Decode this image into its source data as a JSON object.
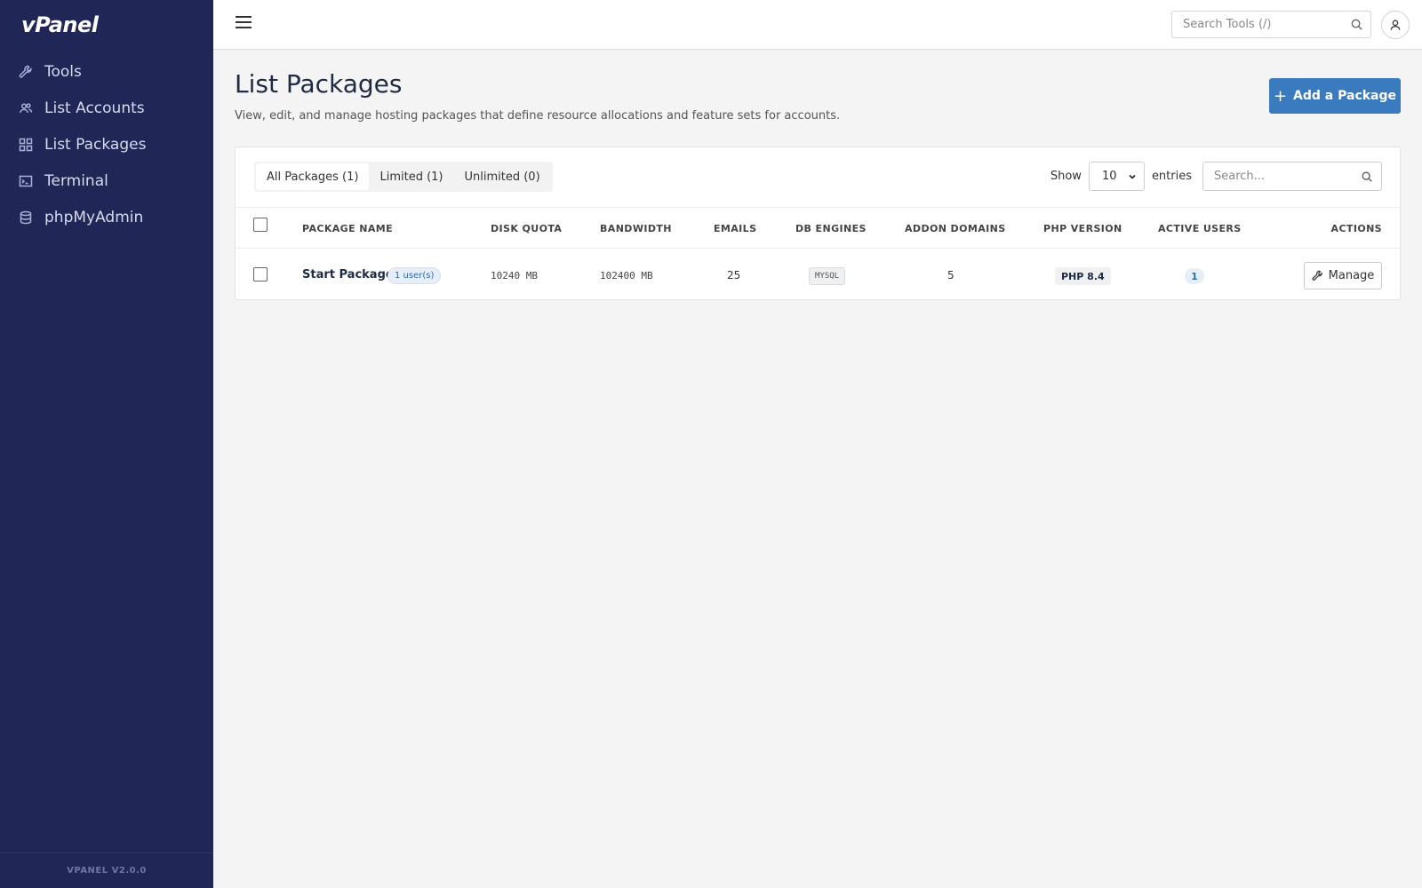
{
  "app": {
    "logo": "vPanel",
    "version": "VPANEL V2.0.0"
  },
  "sidebar": {
    "items": [
      {
        "label": "Tools",
        "icon": "wrench-icon"
      },
      {
        "label": "List Accounts",
        "icon": "users-icon"
      },
      {
        "label": "List Packages",
        "icon": "grid-icon"
      },
      {
        "label": "Terminal",
        "icon": "terminal-icon"
      },
      {
        "label": "phpMyAdmin",
        "icon": "database-icon"
      }
    ]
  },
  "topbar": {
    "search_placeholder": "Search Tools (/)",
    "menu_icon": "hamburger-icon",
    "user_icon": "user-icon"
  },
  "page": {
    "title": "List Packages",
    "subtitle": "View, edit, and manage hosting packages that define resource allocations and feature sets for accounts.",
    "add_button": "Add a Package"
  },
  "filters": {
    "tabs": [
      {
        "label": "All Packages (1)",
        "active": true
      },
      {
        "label": "Limited (1)",
        "active": false
      },
      {
        "label": "Unlimited (0)",
        "active": false
      }
    ],
    "show_label": "Show",
    "entries_value": "10",
    "entries_label": "entries",
    "search_placeholder": "Search..."
  },
  "table": {
    "headers": {
      "package_name": "PACKAGE NAME",
      "disk_quota": "DISK QUOTA",
      "bandwidth": "BANDWIDTH",
      "emails": "EMAILS",
      "db_engines": "DB ENGINES",
      "addon_domains": "ADDON DOMAINS",
      "php_version": "PHP VERSION",
      "active_users": "ACTIVE USERS",
      "actions": "ACTIONS"
    },
    "rows": [
      {
        "name": "Start Package",
        "users_badge": "1 user(s)",
        "disk_quota": "10240 MB",
        "bandwidth": "102400 MB",
        "emails": "25",
        "db_engine": "MYSQL",
        "addon_domains": "5",
        "php_version": "PHP 8.4",
        "active_users": "1",
        "action_label": "Manage"
      }
    ]
  },
  "colors": {
    "sidebar_bg": "#202656",
    "primary": "#3a7bbf",
    "page_bg": "#f4f4f4"
  }
}
